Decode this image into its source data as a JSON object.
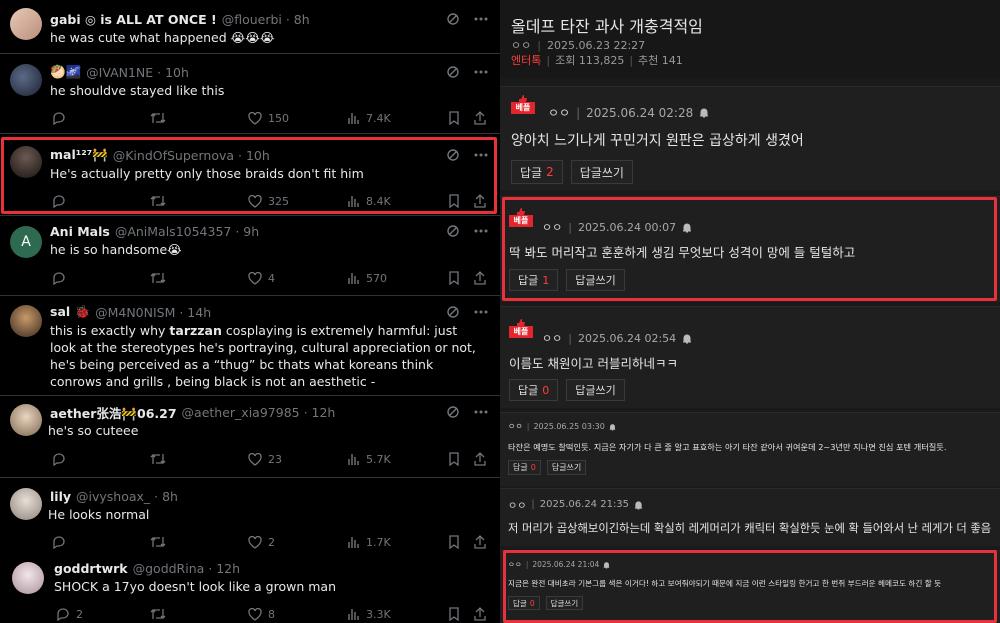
{
  "tweets": [
    {
      "name": "gabi ◎ is ALL AT ONCE !",
      "handle": "@flouerbi · 8h",
      "text": "he was cute what happened 😭😭😭",
      "reply": "",
      "retweet": "",
      "like": "",
      "views": ""
    },
    {
      "name": "🥙🌌",
      "handle": "@IVAN1NE · 10h",
      "text": "he shouldve stayed like this",
      "reply": "",
      "retweet": "",
      "like": "150",
      "views": "7.4K"
    },
    {
      "name": "mal¹²⁷🚧",
      "handle": "@KindOfSupernova · 10h",
      "text": "He's actually pretty only those braids don't fit him",
      "reply": "",
      "retweet": "",
      "like": "325",
      "views": "8.4K"
    },
    {
      "name": "Ani Mals",
      "handle": "@AniMals1054357 · 9h",
      "text": "he is so handsome😭",
      "reply": "",
      "retweet": "",
      "like": "4",
      "views": "570",
      "avatar_letter": "A"
    },
    {
      "name": "sal 🐞",
      "handle": "@M4N0NISM · 14h",
      "text_pre": "this is exactly why ",
      "text_bold": "tarzzan",
      "text_post": " cosplaying is extremely harmful: just look at the stereotypes he's portraying, cultural appreciation or not, he's being perceived as a “thug” bc thats what koreans think conrows and grills , being black is not an aesthetic -",
      "reply": "",
      "retweet": "",
      "like": "",
      "views": ""
    },
    {
      "name": "aether张浩🚧06.27",
      "handle": "@aether_xia97985 · 12h",
      "text": "he's so cuteee",
      "reply": "",
      "retweet": "",
      "like": "23",
      "views": "5.7K"
    },
    {
      "name": "lily",
      "handle": "@ivyshoax_ · 8h",
      "text": "He looks normal",
      "reply": "",
      "retweet": "",
      "like": "2",
      "views": "1.7K"
    },
    {
      "name": "goddrtwrk",
      "handle": "@goddRina · 12h",
      "text": "SHOCK a 17yo doesn't look like a grown man",
      "reply": "2",
      "retweet": "",
      "like": "8",
      "views": "3.3K"
    }
  ],
  "post": {
    "title": "올데프 타잔 과사 개충격적임",
    "author": "ㅇㅇ",
    "date": "2025.06.23 22:27",
    "category": "엔터톡",
    "views_label": "조회 113,825",
    "recommend_label": "추천 141"
  },
  "best_label": "베플",
  "reply_label": "답글",
  "write_label": "답글쓰기",
  "comments": [
    {
      "user": "ㅇㅇ",
      "date": "2025.06.24 02:28",
      "text": "양아치 느기나게 꾸민거지 원판은 곱상하게 생겼어",
      "replies": "2"
    },
    {
      "user": "ㅇㅇ",
      "date": "2025.06.24 00:07",
      "text": "딱 봐도 머리작고 훈훈하게 생김 무엇보다 성격이 망에 들 털털하고",
      "replies": "1"
    },
    {
      "user": "ㅇㅇ",
      "date": "2025.06.24 02:54",
      "text": "이름도 채원이고 러블리하네ㅋㅋ",
      "replies": "0"
    },
    {
      "user": "ㅇㅇ",
      "date": "2025.06.25 03:30",
      "text": "타잔은 예명도 찰떡인듯. 지금은 자기가 다 큰 줄 알고 표효하는 아기 타잔 같아서 귀여운데 2~3년만 지나면 진심 포텐 개터질듯.",
      "replies": "0"
    },
    {
      "user": "ㅇㅇ",
      "date": "2025.06.24 21:35",
      "text": "저 머리가 곱상해보이긴하는데 확실히 레게머리가 캐릭터 확실한듯 눈에 확 들어와서 난 레게가 더 좋음",
      "replies": ""
    },
    {
      "user": "ㅇㅇ",
      "date": "2025.06.24 21:04",
      "text": "지금은 완전 대비초라 기본그룹 색은 이거다! 하고 보여줘야되기 때문에 지금 이런 스타일링 한거고 한 번쥐 부드러운 헤메코도 하긴 할 듯",
      "replies": "0"
    }
  ],
  "colors": {
    "highlight": "#e8313a",
    "best_badge": "#e3262e",
    "reply_count": "#ff3d3d"
  }
}
